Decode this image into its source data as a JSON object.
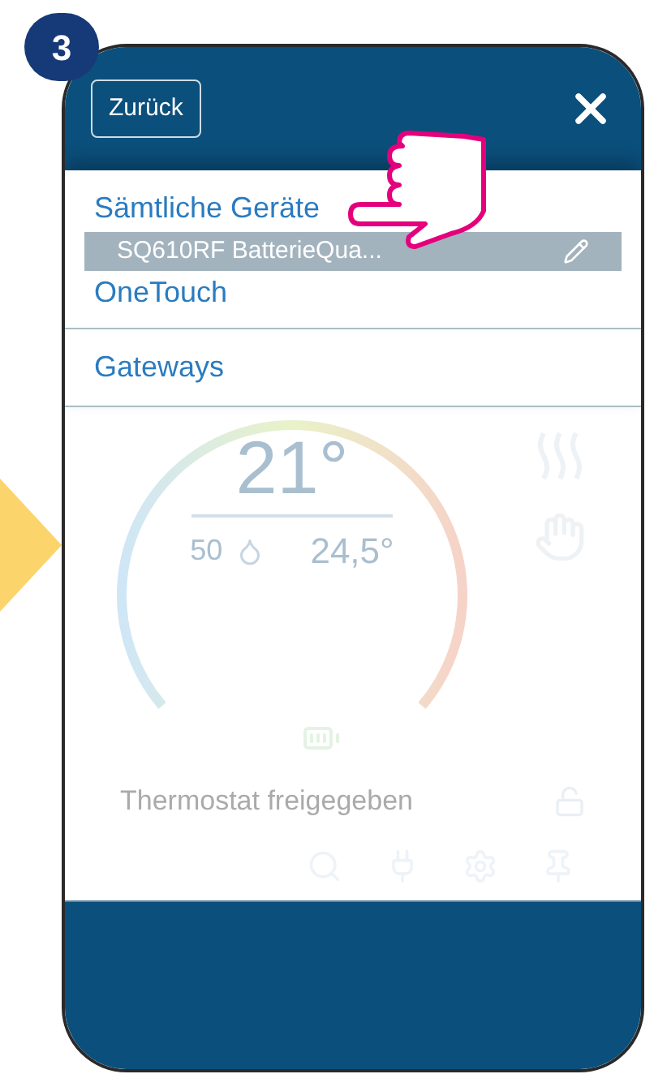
{
  "step_badge": "3",
  "header": {
    "back_button": "Zurück"
  },
  "menu": {
    "items": [
      {
        "label": "Sämtliche Geräte"
      },
      {
        "label": "OneTouch"
      },
      {
        "label": "Gateways"
      }
    ]
  },
  "device": {
    "title": "SQ610RF BatterieQua...",
    "set_temperature": "21°",
    "humidity": "50",
    "current_temperature": "24,5°",
    "status": "Thermostat freigegeben"
  }
}
